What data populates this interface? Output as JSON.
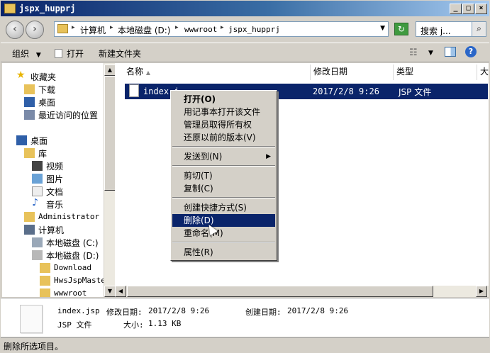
{
  "window": {
    "title": "jspx_hupprj"
  },
  "address": {
    "crumbs": [
      "计算机",
      "本地磁盘 (D:)",
      "wwwroot",
      "jspx_hupprj"
    ],
    "search_text": "搜索 j..."
  },
  "toolbar": {
    "organize": "组织",
    "open": "打开",
    "new_folder": "新建文件夹"
  },
  "nav": {
    "favorites": "收藏夹",
    "downloads": "下载",
    "desktop_fav": "桌面",
    "recent": "最近访问的位置",
    "desktop": "桌面",
    "library": "库",
    "video": "视频",
    "pictures": "图片",
    "documents": "文档",
    "music": "音乐",
    "admin": "Administrator",
    "computer": "计算机",
    "drive_c": "本地磁盘 (C:)",
    "drive_d": "本地磁盘 (D:)",
    "folders": [
      "Download",
      "HwsJspMaster",
      "wwwroot"
    ]
  },
  "columns": {
    "name": "名称",
    "modified": "修改日期",
    "type": "类型",
    "more": "大"
  },
  "file": {
    "name": "index.jsp",
    "name_visible": "index.j",
    "modified": "2017/2/8 9:26",
    "type": "JSP 文件"
  },
  "context_menu": {
    "open": "打开(O)",
    "open_notepad": "用记事本打开该文件",
    "take_ownership": "管理员取得所有权",
    "restore": "还原以前的版本(V)",
    "send_to": "发送到(N)",
    "cut": "剪切(T)",
    "copy": "复制(C)",
    "create_shortcut": "创建快捷方式(S)",
    "delete": "删除(D)",
    "rename": "重命名(M)",
    "properties": "属性(R)"
  },
  "details": {
    "filename": "index.jsp",
    "modified_label": "修改日期:",
    "modified_value": "2017/2/8 9:26",
    "created_label": "创建日期:",
    "created_value": "2017/2/8 9:26",
    "type": "JSP 文件",
    "size_label": "大小:",
    "size_value": "1.13 KB"
  },
  "status": {
    "text": "删除所选项目。"
  },
  "colors": {
    "selection": "#0a246a",
    "face": "#d4d0c8"
  }
}
